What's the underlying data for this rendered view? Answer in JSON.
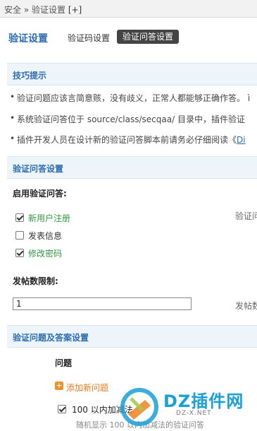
{
  "breadcrumb": {
    "path": "安全 » 验证设置",
    "add": "[+]"
  },
  "header": {
    "title": "验证设置",
    "tabs": [
      {
        "label": "验证码设置",
        "active": false
      },
      {
        "label": "验证问答设置",
        "active": true
      }
    ]
  },
  "tips": {
    "title": "技巧提示",
    "items": [
      "验证问题应该言简意赅，没有歧义，正常人都能够正确作答。 ì",
      "系统验证问答位于 source/class/secqaa/ 目录中，插件验证",
      "插件开发人员在设计新的验证问答脚本前请务必仔细阅读《"
    ],
    "link_text": "Di"
  },
  "qa_settings": {
    "title": "验证问答设置",
    "enable_label": "启用验证问答:",
    "options": [
      {
        "label": "新用户注册",
        "checked": true
      },
      {
        "label": "发表信息",
        "checked": false
      },
      {
        "label": "修改密码",
        "checked": true
      }
    ],
    "enable_note": "验证问",
    "post_limit_label": "发帖数限制:",
    "post_limit_value": "1",
    "post_limit_note": "发帖数"
  },
  "qa_answers": {
    "title": "验证问题及答案设置",
    "column_question": "问题",
    "add_label": "添加新问题",
    "question_text": "100 以内加减法",
    "question_note": "随机显示 100 以内加减法的验证问答",
    "question_checked": true
  },
  "watermark": {
    "title": "DZ插件网",
    "subtitle": "DZ-X.NET"
  },
  "colors": {
    "accent": "#2b6cb0",
    "green": "#2f9a3f",
    "orange": "#e07a1f",
    "section_bg": "#eef5fa"
  }
}
